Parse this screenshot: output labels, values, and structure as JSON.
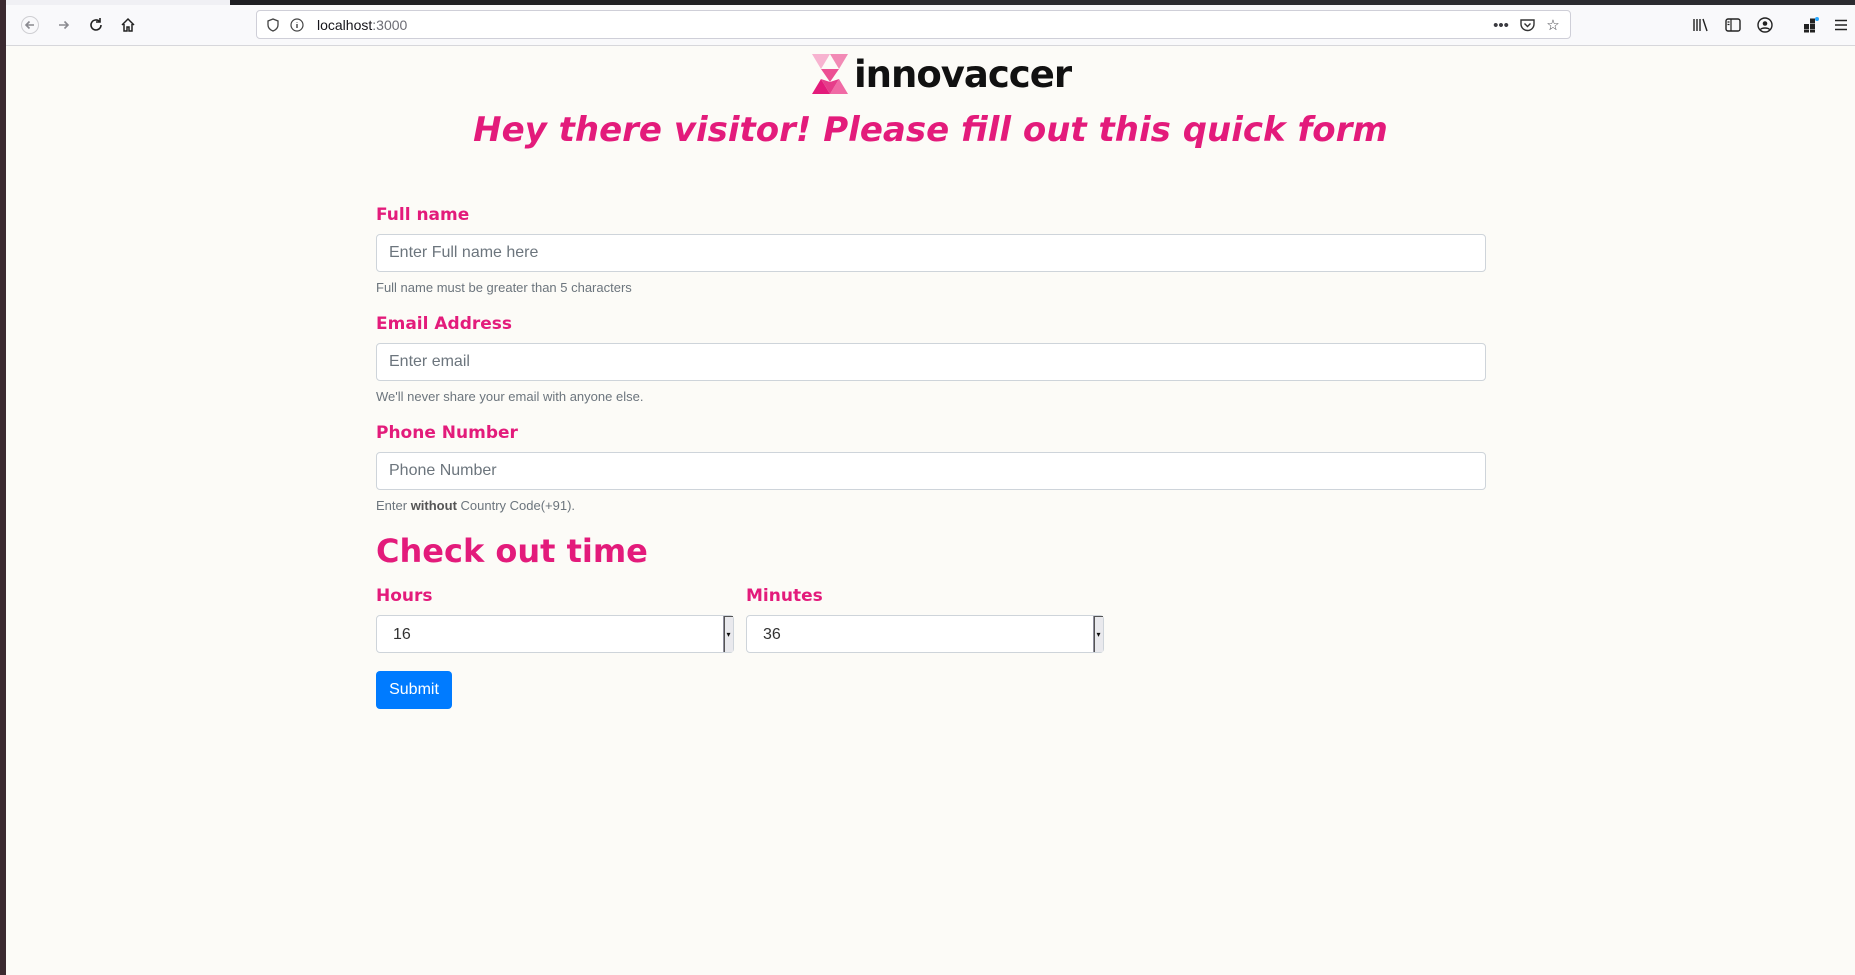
{
  "browser": {
    "url_host": "localhost",
    "url_port": ":3000",
    "icons": {
      "back": "arrow-left-icon",
      "forward": "arrow-right-icon",
      "reload": "reload-icon",
      "home": "home-icon",
      "shield": "tracking-shield-icon",
      "info": "site-info-icon",
      "more": "more-dots-icon",
      "pocket": "pocket-icon",
      "bookmark": "star-icon",
      "library": "library-icon",
      "sidebar": "sidebar-icon",
      "account": "account-icon",
      "extensions": "extensions-icon",
      "menu": "hamburger-menu-icon"
    }
  },
  "page": {
    "brand": "innovaccer",
    "headline": "Hey there visitor! Please fill out this quick form",
    "accent_color": "#e31b7b",
    "form": {
      "full_name": {
        "label": "Full name",
        "placeholder": "Enter Full name here",
        "help": "Full name must be greater than 5 characters"
      },
      "email": {
        "label": "Email Address",
        "placeholder": "Enter email",
        "help": "We'll never share your email with anyone else."
      },
      "phone": {
        "label": "Phone Number",
        "placeholder": "Phone Number",
        "help_prefix": "Enter ",
        "help_bold": "without",
        "help_suffix": " Country Code(+91)."
      },
      "checkout_title": "Check out time",
      "hours": {
        "label": "Hours",
        "value": "16"
      },
      "minutes": {
        "label": "Minutes",
        "value": "36"
      },
      "submit_label": "Submit",
      "submit_color": "#007bff"
    }
  }
}
